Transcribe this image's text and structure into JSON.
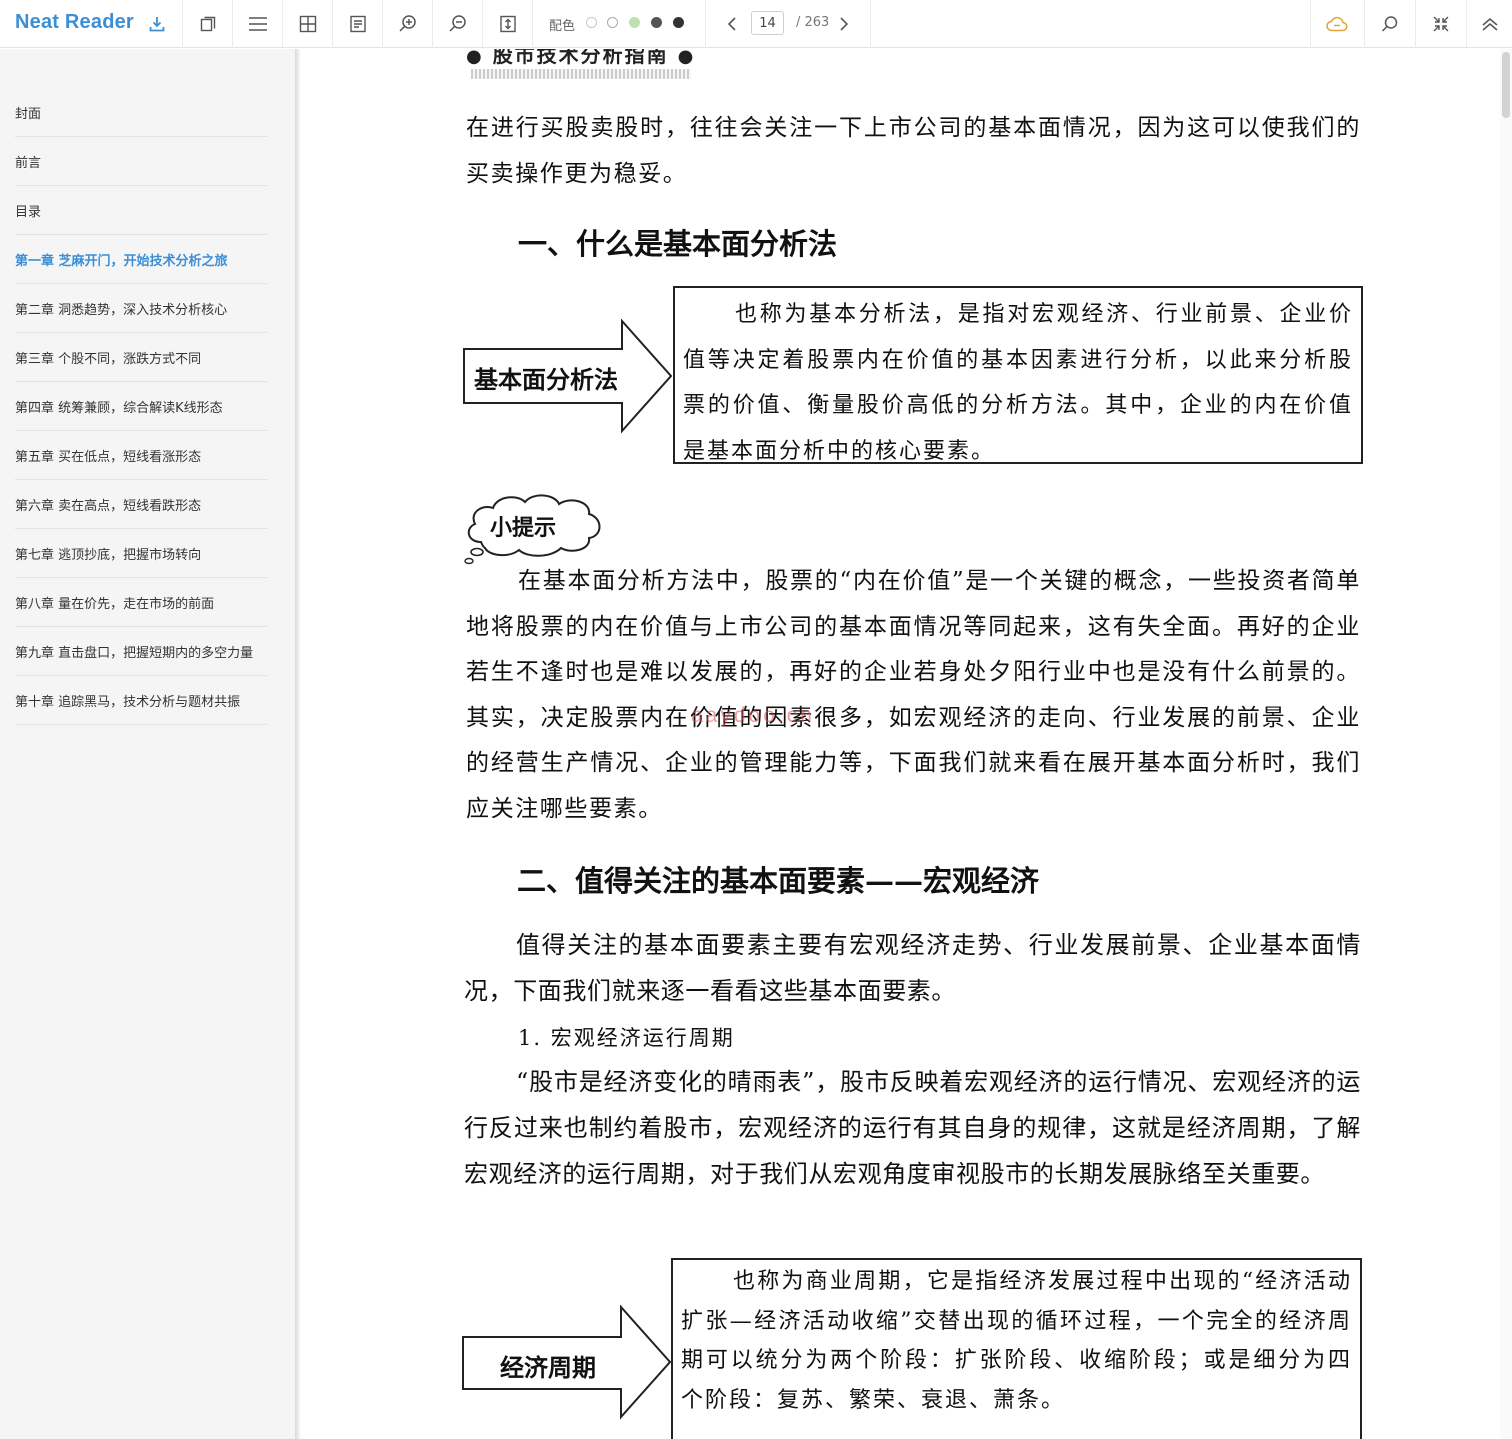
{
  "app": {
    "name": "Neat Reader"
  },
  "toolbar": {
    "palette_label": "配色",
    "palette_colors": [
      "#ffffff",
      "#ffffff",
      "#bfe1ad",
      "#555555",
      "#333333"
    ],
    "page_current": "14",
    "page_total": "/ 263"
  },
  "toc": {
    "items": [
      {
        "label": "封面"
      },
      {
        "label": "前言"
      },
      {
        "label": "目录"
      },
      {
        "label": "第一章 芝麻开门，开始技术分析之旅"
      },
      {
        "label": "第二章 洞悉趋势，深入技术分析核心"
      },
      {
        "label": "第三章 个股不同，涨跌方式不同"
      },
      {
        "label": "第四章 统筹兼顾，综合解读K线形态"
      },
      {
        "label": "第五章 买在低点，短线看涨形态"
      },
      {
        "label": "第六章 卖在高点，短线看跌形态"
      },
      {
        "label": "第七章 逃顶抄底，把握市场转向"
      },
      {
        "label": "第八章 量在价先，走在市场的前面"
      },
      {
        "label": "第九章 直击盘口，把握短期内的多空力量"
      },
      {
        "label": "第十章 追踪黑马，技术分析与题材共振"
      }
    ],
    "active_index": 3
  },
  "content": {
    "running_header": "股市技术分析指南",
    "intro": "在进行买股卖股时，往往会关注一下上市公司的基本面情况，因为这可以使我们的买卖操作更为稳妥。",
    "section1_title": "一、什么是基本面分析法",
    "arrow1_label": "基本面分析法",
    "box1_text": "也称为基本分析法，是指对宏观经济、行业前景、企业价值等决定着股票内在价值的基本因素进行分析，以此来分析股票的价值、衡量股价高低的分析方法。其中，企业的内在价值是基本面分析中的核心要素。",
    "tip_label": "小提示",
    "tip_text": "在基本面分析方法中，股票的“内在价值”是一个关键的概念，一些投资者简单地将股票的内在价值与上市公司的基本面情况等同起来，这有失全面。再好的企业若生不逢时也是难以发展的，再好的企业若身处夕阳行业中也是没有什么前景的。其实，决定股票内在价值的因素很多，如宏观经济的走向、行业发展的前景、企业的经营生产情况、企业的管理能力等，下面我们就来看在展开基本面分析时，我们应关注哪些要素。",
    "watermark": "aaydoo.cn",
    "section2_title": "二、值得关注的基本面要素——宏观经济",
    "section2_intro": "值得关注的基本面要素主要有宏观经济走势、行业发展前景、企业基本面情况，下面我们就来逐一看看这些基本面要素。",
    "subsection1": "1. 宏观经济运行周期",
    "sub1_text": "“股市是经济变化的晴雨表”，股市反映着宏观经济的运行情况、宏观经济的运行反过来也制约着股市，宏观经济的运行有其自身的规律，这就是经济周期，了解宏观经济的运行周期，对于我们从宏观角度审视股市的长期发展脉络至关重要。",
    "arrow2_label": "经济周期",
    "box2_text": "也称为商业周期，它是指经济发展过程中出现的“经济活动扩张—经济活动收缩”交替出现的循环过程，一个完全的经济周期可以统分为两个阶段：扩张阶段、收缩阶段；或是细分为四个阶段：复苏、繁荣、衰退、萧条。"
  }
}
